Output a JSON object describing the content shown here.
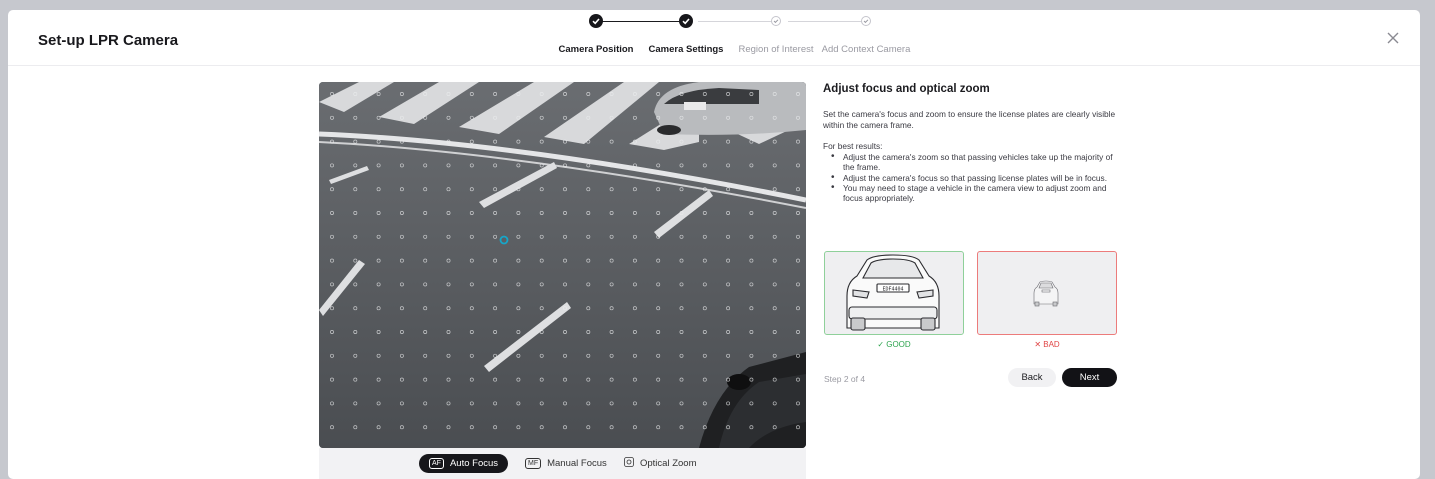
{
  "header": {
    "title": "Set-up LPR Camera"
  },
  "steps": [
    {
      "label": "Camera Position",
      "state": "done"
    },
    {
      "label": "Camera Settings",
      "state": "done"
    },
    {
      "label": "Region of Interest",
      "state": "todo"
    },
    {
      "label": "Add Context Camera",
      "state": "todo"
    }
  ],
  "focus_controls": {
    "auto": {
      "label": "Auto Focus",
      "icon": "AF",
      "active": true
    },
    "manual": {
      "label": "Manual Focus",
      "icon": "MF",
      "active": false
    },
    "zoom": {
      "label": "Optical Zoom",
      "icon": "zoom-icon",
      "active": false
    }
  },
  "side": {
    "heading": "Adjust focus and optical zoom",
    "description": "Set the camera's focus and zoom to ensure the license plates are clearly visible within the camera frame.",
    "best_results": "For best results:",
    "tips": [
      "Adjust the camera's zoom so that passing vehicles take up the majority of the frame.",
      "Adjust the camera's focus so that passing license plates will be in focus.",
      "You may need to stage a vehicle in the camera view to adjust zoom and focus appropriately."
    ],
    "good_label": "✓ GOOD",
    "bad_label": "✕ BAD",
    "plate_text": "EDF4404"
  },
  "footer": {
    "step_count": "Step 2 of 4",
    "back_label": "Back",
    "next_label": "Next"
  },
  "colors": {
    "good": "#2da44e",
    "bad": "#e04545",
    "accent": "#121216",
    "focus_point": "#16a6c9"
  }
}
